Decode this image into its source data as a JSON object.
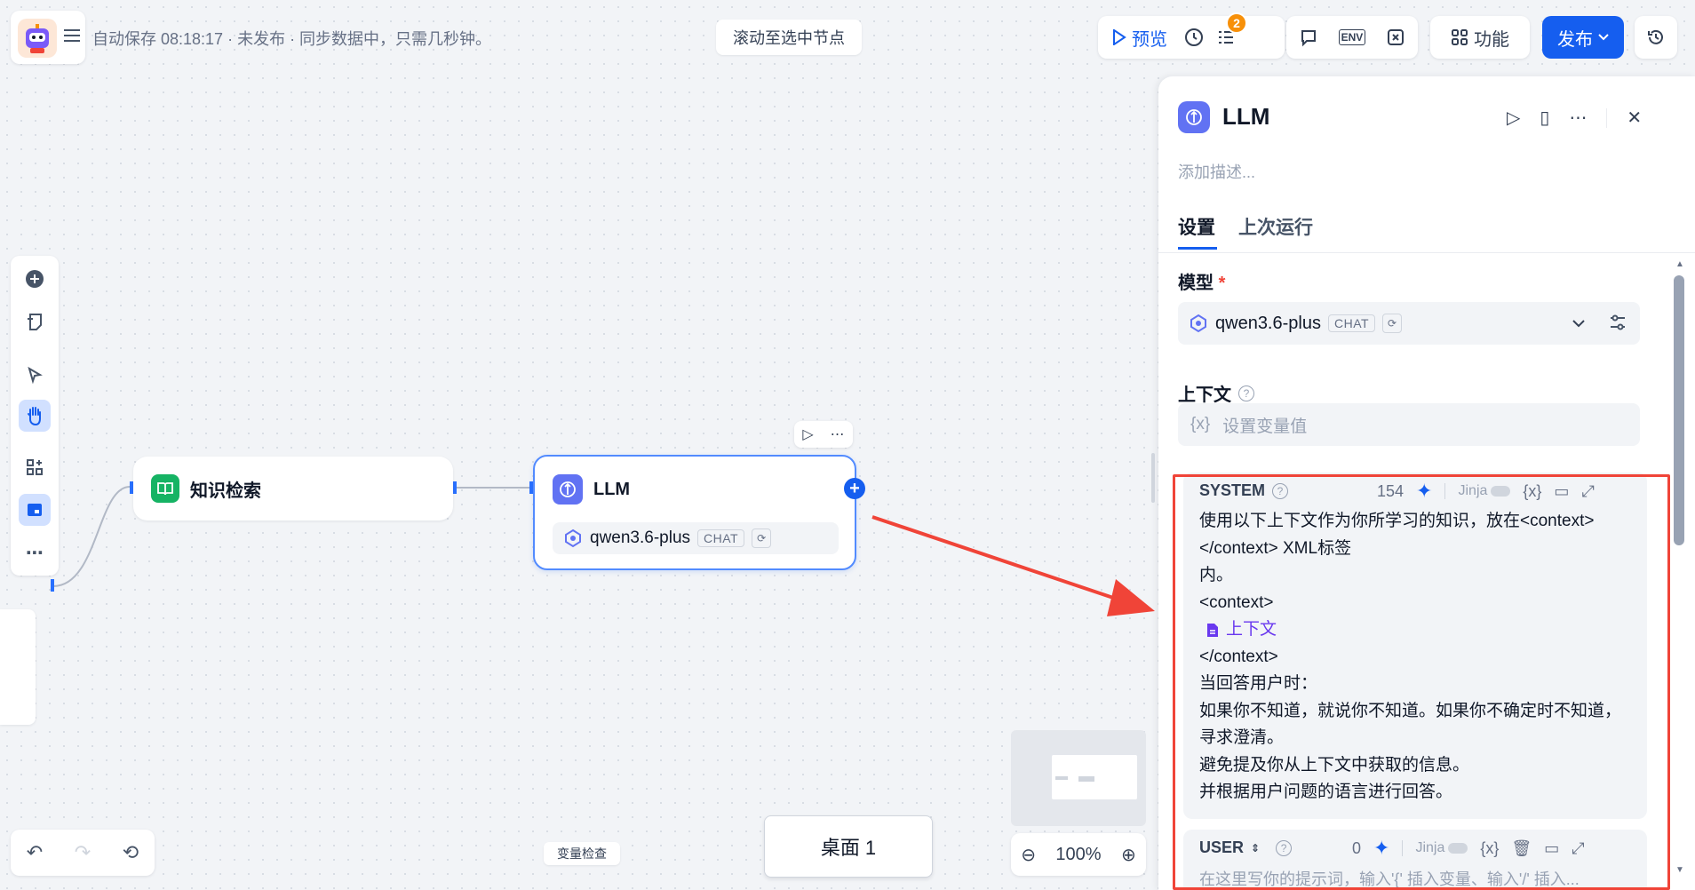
{
  "topbar": {
    "status": "自动保存 08:18:17 · 未发布 · 同步数据中，只需几秒钟。",
    "scroll_to_node": "滚动至选中节点",
    "preview": "预览",
    "checklist_badge": "2",
    "features": "功能",
    "publish": "发布",
    "env_label": "ENV"
  },
  "nodes": {
    "knowledge": {
      "title": "知识检索"
    },
    "llm": {
      "title": "LLM",
      "model": "qwen3.6-plus",
      "mode": "CHAT"
    }
  },
  "bottom": {
    "var_check": "变量检查",
    "desktop": "桌面 1",
    "zoom": "100%"
  },
  "panel": {
    "title": "LLM",
    "description_placeholder": "添加描述...",
    "tabs": [
      "设置",
      "上次运行"
    ],
    "model_label": "模型",
    "required_mark": "*",
    "model_name": "qwen3.6-plus",
    "model_mode": "CHAT",
    "context_label": "上下文",
    "context_placeholder": "设置变量值",
    "var_icon": "{x}",
    "system": {
      "label": "SYSTEM",
      "count": "154",
      "jinja": "Jinja",
      "lines": [
        "使用以下上下文作为你所学习的知识，放在<context></context> XML标签",
        "内。",
        "<context>"
      ],
      "context_chip": "上下文",
      "lines_after": [
        "</context>",
        "当回答用户时：",
        "如果你不知道，就说你不知道。如果你不确定时不知道，寻求澄清。",
        "避免提及你从上下文中获取的信息。",
        "并根据用户问题的语言进行回答。"
      ]
    },
    "user": {
      "label": "USER",
      "count": "0",
      "jinja": "Jinja",
      "placeholder": "在这里写你的提示词，输入'{' 插入变量、输入'/' 插入..."
    }
  },
  "colors": {
    "accent": "#155eef",
    "highlight": "#f04438",
    "green": "#16b364",
    "llm": "#6172f3"
  }
}
